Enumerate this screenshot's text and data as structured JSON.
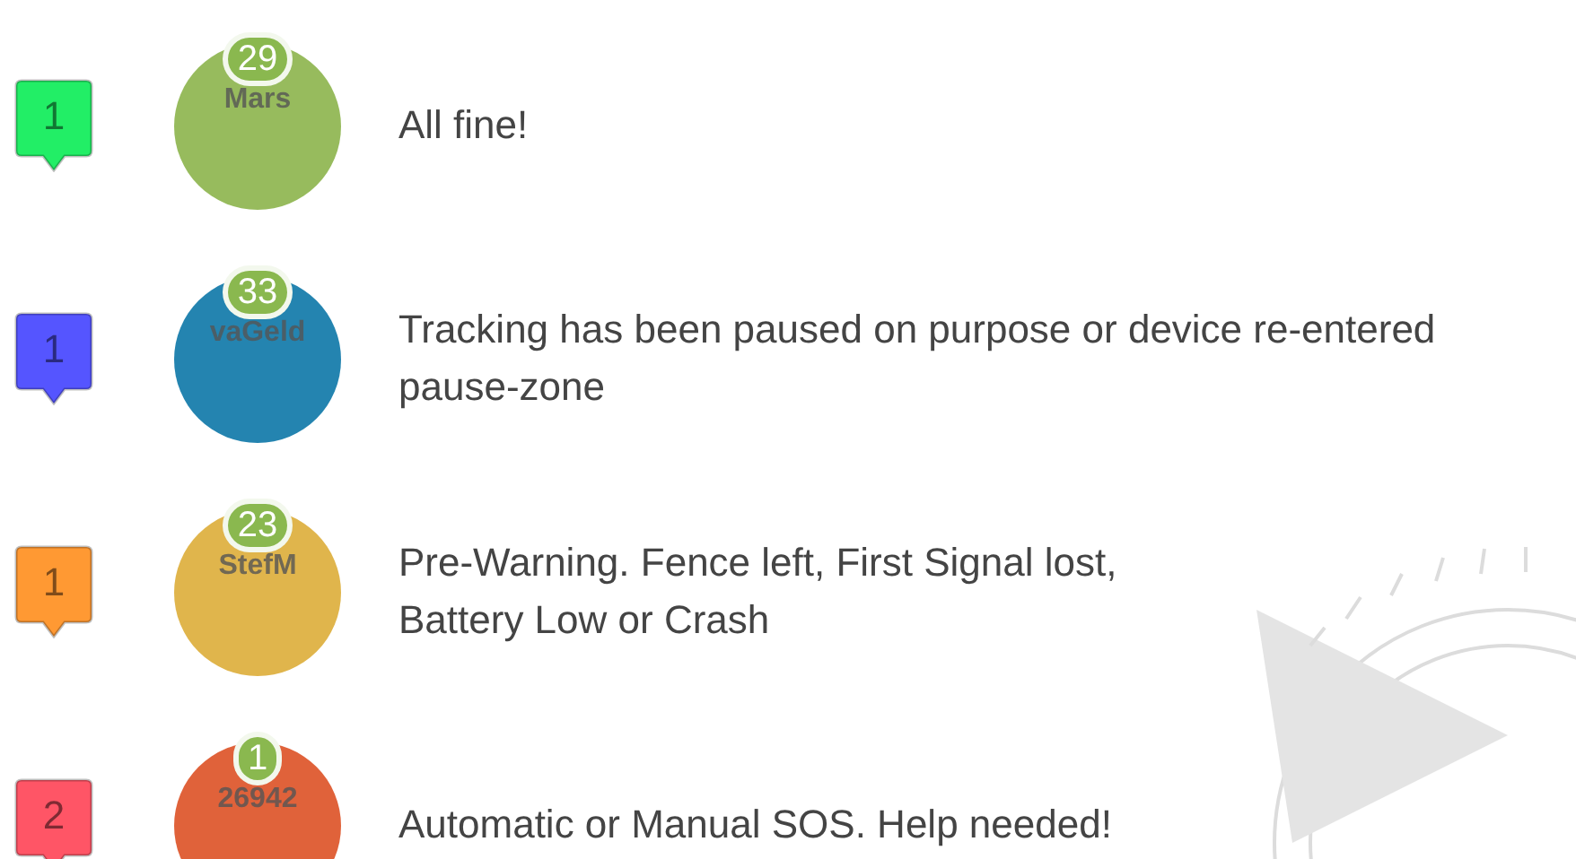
{
  "legend": [
    {
      "marker": {
        "label": "1",
        "color": "#22ee66"
      },
      "bubble": {
        "count": "29",
        "name": "Mars",
        "color": "#97bb5d"
      },
      "description": "All fine!"
    },
    {
      "marker": {
        "label": "1",
        "color": "#5555ff"
      },
      "bubble": {
        "count": "33",
        "name": "vaGeld",
        "color": "#2484b0"
      },
      "description": "Tracking has been paused on purpose or device re-entered pause-zone"
    },
    {
      "marker": {
        "label": "1",
        "color": "#ff9933"
      },
      "bubble": {
        "count": "23",
        "name": "StefM",
        "color": "#e0b54c"
      },
      "description": "Pre-Warning. Fence left, First Signal lost,\nBattery Low or Crash"
    },
    {
      "marker": {
        "label": "2",
        "color": "#ff5566"
      },
      "bubble": {
        "count": "1",
        "name": "26942",
        "color": "#e0623a"
      },
      "description": "Automatic or Manual SOS. Help needed!"
    }
  ]
}
